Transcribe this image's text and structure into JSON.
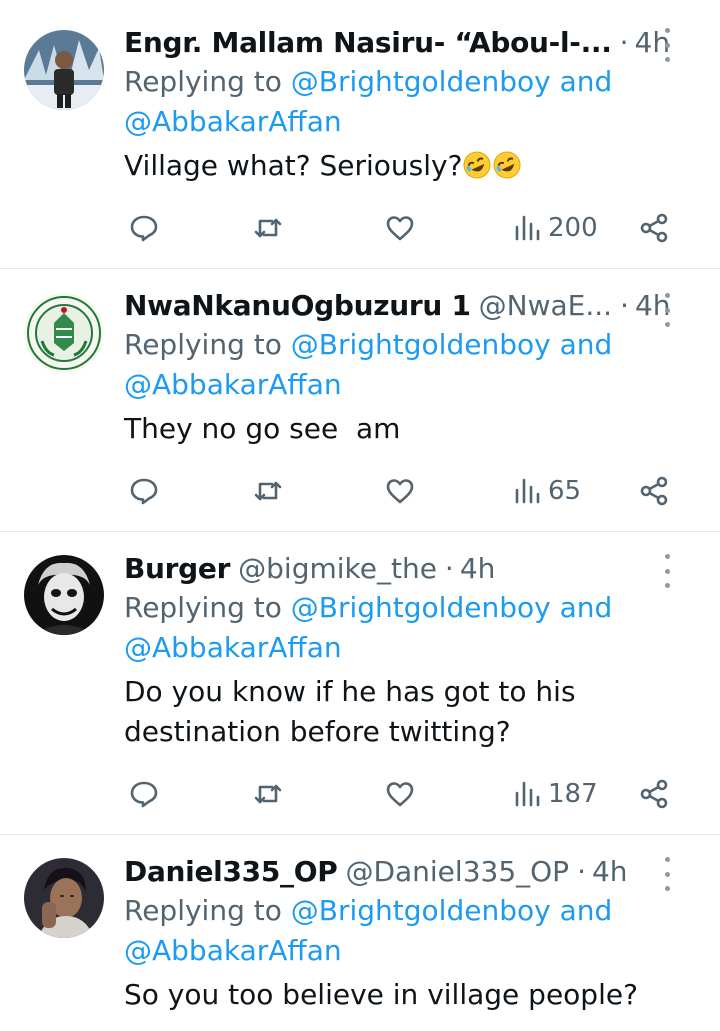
{
  "tweets": [
    {
      "name": "Engr. Mallam Nasiru- “Abou-l-...",
      "handle": "",
      "time": "4h",
      "replying_prefix": "Replying to",
      "mention1": "@Brightgoldenboy",
      "and": "and",
      "mention2": "@AbbakarAffan",
      "text": "Village what? Seriously?",
      "emoji": [
        "rolling-on-floor-laughing-emoji",
        "rolling-on-floor-laughing-emoji"
      ],
      "views": "200",
      "avatar": "man-in-snowy-forest"
    },
    {
      "name": "NwaNkanuOgbuzuru 1",
      "handle": "@NwaE...",
      "time": "4h",
      "replying_prefix": "Replying to",
      "mention1": "@Brightgoldenboy",
      "and": "and",
      "mention2": "@AbbakarAffan",
      "text": "They no go see  am",
      "views": "65",
      "avatar": "enugu-state-seal"
    },
    {
      "name": "Burger",
      "handle": "@bigmike_the",
      "time": "4h",
      "replying_prefix": "Replying to",
      "mention1": "@Brightgoldenboy",
      "and": "and",
      "mention2": "@AbbakarAffan",
      "text_line1": "Do you know if he has got to his",
      "text_line2": "destination before twitting?",
      "views": "187",
      "avatar": "joker-face"
    },
    {
      "name": "Daniel335_OP",
      "handle": "@Daniel335_OP",
      "time": "4h",
      "replying_prefix": "Replying to",
      "mention1": "@Brightgoldenboy",
      "and": "and",
      "mention2": "@AbbakarAffan",
      "text": "So you too believe in village people?",
      "avatar": "man-portrait-dark"
    }
  ],
  "separator": "·",
  "colors": {
    "text": "#0f1419",
    "muted": "#536471",
    "link": "#1d9bf0",
    "border": "#e6e9eb"
  }
}
